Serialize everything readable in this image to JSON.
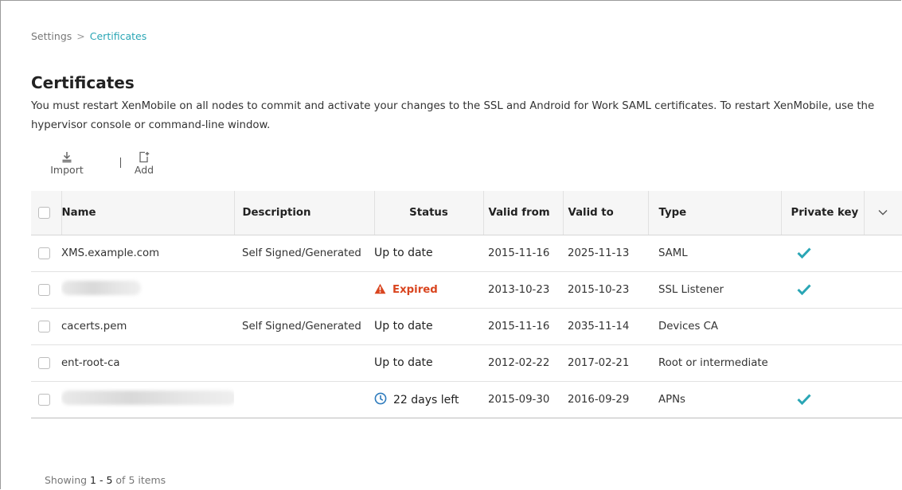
{
  "breadcrumb": {
    "parent": "Settings",
    "separator": ">",
    "current": "Certificates"
  },
  "page": {
    "title": "Certificates",
    "description": "You must restart XenMobile on all nodes to commit and activate your changes to the SSL and Android for Work SAML certificates. To restart XenMobile, use the hypervisor console or command-line window."
  },
  "toolbar": {
    "import_label": "Import",
    "add_label": "Add",
    "import_icon": "download-icon",
    "add_icon": "add-file-icon"
  },
  "table": {
    "columns": {
      "name": "Name",
      "description": "Description",
      "status": "Status",
      "valid_from": "Valid from",
      "valid_to": "Valid to",
      "type": "Type",
      "private_key": "Private key"
    },
    "rows": [
      {
        "name": "XMS.example.com",
        "description": "Self Signed/Generated",
        "status": "Up to date",
        "valid_from": "2015-11-16",
        "valid_to": "2025-11-13",
        "type": "SAML",
        "private_key": true
      },
      {
        "name": "",
        "description": "",
        "status": "Expired",
        "valid_from": "2013-10-23",
        "valid_to": "2015-10-23",
        "type": "SSL Listener",
        "private_key": true
      },
      {
        "name": "cacerts.pem",
        "description": "Self Signed/Generated",
        "status": "Up to date",
        "valid_from": "2015-11-16",
        "valid_to": "2035-11-14",
        "type": "Devices CA",
        "private_key": false
      },
      {
        "name": "ent-root-ca",
        "description": "",
        "status": "Up to date",
        "valid_from": "2012-02-22",
        "valid_to": "2017-02-21",
        "type": "Root or intermediate",
        "private_key": false
      },
      {
        "name": "",
        "description": "",
        "status": "22 days left",
        "valid_from": "2015-09-30",
        "valid_to": "2016-09-29",
        "type": "APNs",
        "private_key": true
      }
    ]
  },
  "footer": {
    "prefix": "Showing",
    "range": "1 - 5",
    "of_label": "of",
    "count": "5 items"
  },
  "colors": {
    "accent": "#2aa6b5",
    "expired": "#d9451f",
    "checkmark": "#2aa6b5",
    "clock": "#2e7bbd"
  }
}
